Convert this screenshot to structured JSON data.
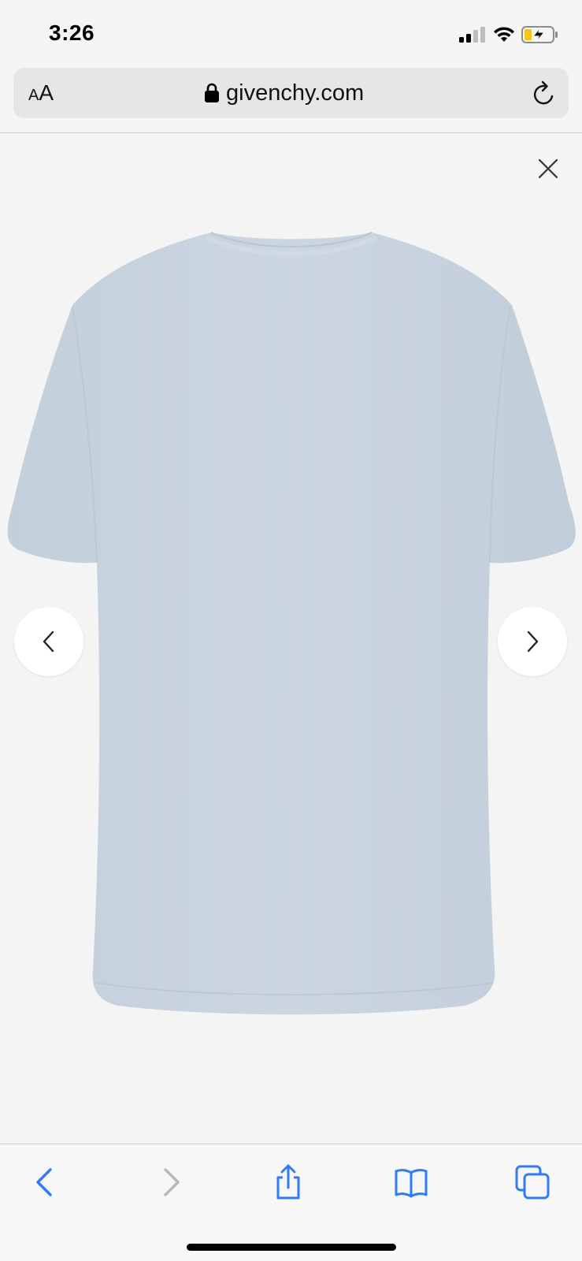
{
  "status_bar": {
    "time": "3:26",
    "icons": [
      "cellular-signal-icon",
      "wifi-icon",
      "battery-charging-icon"
    ]
  },
  "address_bar": {
    "text_size_small": "A",
    "text_size_large": "A",
    "url": "givenchy.com",
    "icons": [
      "lock-icon",
      "reload-icon"
    ]
  },
  "gallery": {
    "icons": [
      "close-icon",
      "chevron-left-icon",
      "chevron-right-icon"
    ],
    "product_color": "#c8d3df"
  },
  "toolbar": {
    "icons": [
      "back-icon",
      "forward-icon",
      "share-icon",
      "bookmarks-icon",
      "tabs-icon"
    ],
    "accent": "#2f7cf6",
    "disabled": "#b9b9b9"
  }
}
